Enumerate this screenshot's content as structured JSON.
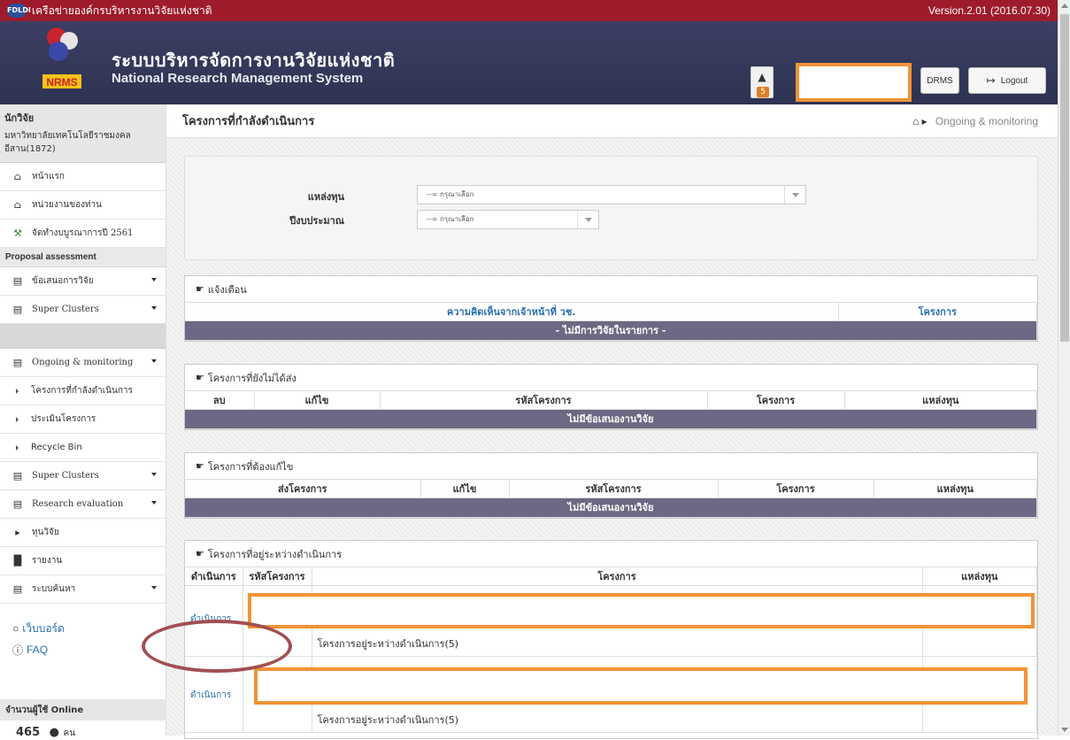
{
  "topbar": {
    "logo": "FDLDI",
    "network": "เครือข่ายองค์กรบริหารงานวิจัยแห่งชาติ",
    "version": "Version.2.01 (2016.07.30)"
  },
  "header": {
    "title_th": "ระบบบริหารจัดการงานวิจัยแห่งชาติ",
    "title_en": "National Research Management System",
    "logo_text": "NRMS",
    "notif_count": "5",
    "drms": "DRMS",
    "logout": "Logout"
  },
  "sidebar": {
    "role": "นักวิจัย",
    "org": "มหาวิทยาลัยเทคโนโลยีราชมงคลอีสาน(1872)",
    "items_top": [
      {
        "label": "หน้าแรก",
        "icon": "home-icon"
      },
      {
        "label": "หน่วยงานของท่าน",
        "icon": "home-icon"
      },
      {
        "label": "จัดทำงบบูรณาการปี 2561",
        "icon": "gavel-icon"
      }
    ],
    "section": "Proposal assessment",
    "items_proposal": [
      "ข้อเสนอการวิจัย",
      "Super Clusters"
    ],
    "ongoing": "Ongoing & monitoring",
    "ongoing_sub": [
      "โครงการที่กำลังดำเนินการ",
      "ประเมินโครงการ",
      "Recycle Bin"
    ],
    "items_more": [
      "Super Clusters",
      "Research evaluation"
    ],
    "funding": "ทุนวิจัย",
    "report": "รายงาน",
    "search": "ระบบค้นหา",
    "webboard": "เว็บบอร์ด",
    "faq": "FAQ",
    "online_label": "จำนวนผู้ใช้ Online",
    "online_count": "465",
    "online_unit": "คน"
  },
  "page": {
    "title": "โครงการที่กำลังดำเนินการ",
    "breadcrumb": "Ongoing & monitoring"
  },
  "filter": {
    "source_label": "แหล่งทุน",
    "source_value": "--= กรุณาเลือก",
    "year_label": "ปีงบประมาณ",
    "year_value": "--= กรุณาเลือก"
  },
  "panels": {
    "alert": {
      "title": "แจ้งเตือน",
      "cols": [
        "ความคิดเห็นจากเจ้าหน้าที่ วช.",
        "โครงการ"
      ],
      "empty": "- ไม่มีการวิจัยในรายการ -"
    },
    "unsent": {
      "title": "โครงการที่ยังไม่ได้ส่ง",
      "cols": [
        "ลบ",
        "แก้ไข",
        "รหัสโครงการ",
        "โครงการ",
        "แหล่งทุน"
      ],
      "empty": "ไม่มีข้อเสนองานวิจัย"
    },
    "revise": {
      "title": "โครงการที่ต้องแก้ไข",
      "cols": [
        "ส่งโครงการ",
        "แก้ไข",
        "รหัสโครงการ",
        "โครงการ",
        "แหล่งทุน"
      ],
      "empty": "ไม่มีข้อเสนองานวิจัย"
    },
    "ongoing": {
      "title": "โครงการที่อยู่ระหว่างดำเนินการ",
      "cols": [
        "ดำเนินการ",
        "รหัสโครงการ",
        "โครงการ",
        "แหล่งทุน"
      ],
      "rows": [
        {
          "action": "ดำเนินการ",
          "status": "โครงการอยู่ระหว่างดำเนินการ(5)"
        },
        {
          "action": "ดำเนินการ",
          "status": "โครงการอยู่ระหว่างดำเนินการ(5)"
        }
      ]
    }
  }
}
